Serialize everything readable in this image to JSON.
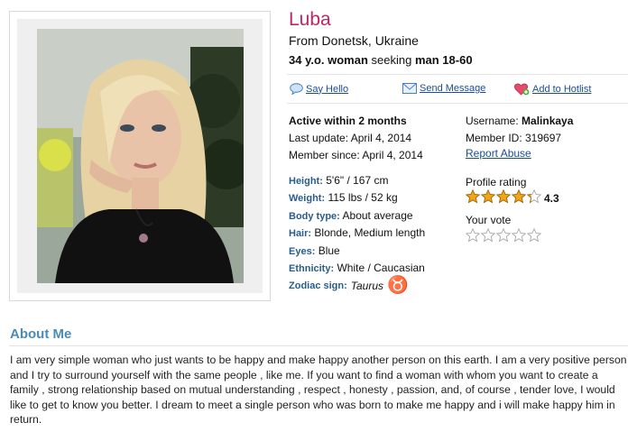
{
  "profile": {
    "name": "Luba",
    "from": "From Donetsk, Ukraine",
    "age": "34 y.o. woman",
    "seeking_word": "seeking",
    "seeking_target": "man 18-60"
  },
  "actions": {
    "say_hello": "Say Hello",
    "send_message": "Send Message",
    "add_hotlist": "Add to Hotlist"
  },
  "activity": {
    "active": "Active within 2 months",
    "last_update": "Last update: April 4, 2014",
    "member_since": "Member since: April 4, 2014"
  },
  "account": {
    "username_label": "Username:",
    "username": "Malinkaya",
    "member_id": "Member ID: 319697",
    "report_abuse": "Report Abuse"
  },
  "rating": {
    "label": "Profile rating",
    "value": "4.3",
    "score": 4.3,
    "max": 5,
    "your_vote_label": "Your vote",
    "your_vote": 0
  },
  "attributes": [
    {
      "key": "Height:",
      "value": "5'6\" / 167 cm"
    },
    {
      "key": "Weight:",
      "value": "115 lbs / 52 kg"
    },
    {
      "key": "Body type:",
      "value": "About average"
    },
    {
      "key": "Hair:",
      "value": "Blonde, Medium length"
    },
    {
      "key": "Eyes:",
      "value": "Blue"
    },
    {
      "key": "Ethnicity:",
      "value": "White / Caucasian"
    },
    {
      "key": "Zodiac sign:",
      "value": "Taurus"
    }
  ],
  "zodiac_symbol": "♉",
  "about": {
    "title": "About Me",
    "text": "I am very simple woman who just wants to be happy and make happy another person on this earth. I am a very positive person and I try to surround yourself with the same people , like me. If you want to find a woman with whom you want to create a family , strong relationship based on mutual understanding , respect , honesty , passion, and, of course , tender love, I would like to get to know you better. I dream to meet a single person who was born to make me happy and i will make happy him in return."
  },
  "colors": {
    "name": "#c0256a",
    "link": "#1a4b9c",
    "attr_key": "#2a5c8c",
    "about_title": "#4a8bb8",
    "star": "#f2a516"
  }
}
